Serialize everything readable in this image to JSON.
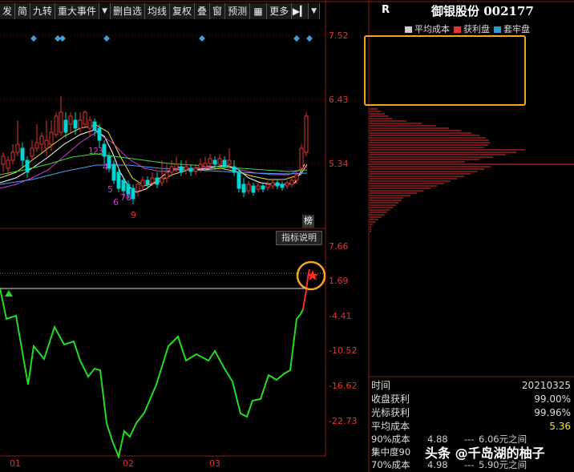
{
  "toolbar": {
    "items": [
      "发",
      "简",
      "九转",
      "重大事件",
      "删自选",
      "均线",
      "复权",
      "叠",
      "窗",
      "预测",
      "更多"
    ],
    "dropdown_after": "重大事件"
  },
  "stock": {
    "prefix": "R",
    "name": "御银股份 002177"
  },
  "legend": {
    "items": [
      {
        "label": "平均成本",
        "color": "#cccccc"
      },
      {
        "label": "获利盘",
        "color": "#e53333"
      },
      {
        "label": "套牢盘",
        "color": "#3399cc"
      }
    ]
  },
  "price_axis": {
    "labels": [
      "7.52",
      "6.43",
      "5.34"
    ]
  },
  "indicator_axis": {
    "labels": [
      "7.66",
      "1.69",
      "-4.41",
      "-10.52",
      "-16.62",
      "-22.73"
    ]
  },
  "date_axis": {
    "labels": [
      "01",
      "02",
      "03"
    ]
  },
  "wave_labels": [
    "1",
    "2",
    "3",
    "4",
    "5",
    "6",
    "7",
    "8",
    "9"
  ],
  "tags": {
    "bang": "榜",
    "indicator_help": "指标说明"
  },
  "info": {
    "rows": [
      {
        "label": "时间",
        "value": "20210325",
        "yellow": false
      },
      {
        "label": "收盘获利",
        "value": "99.00%",
        "yellow": false
      },
      {
        "label": "光标获利",
        "value": "99.96%",
        "yellow": false
      },
      {
        "label": "平均成本",
        "value": "5.36",
        "yellow": true
      }
    ]
  },
  "concentration": {
    "rows": [
      {
        "label": "90%成本",
        "low": "4.88",
        "sep": "---",
        "high": "6.06元之间"
      },
      {
        "label": "集中度90",
        "low": "",
        "sep": "",
        "high": ""
      },
      {
        "label": "70%成本",
        "low": "4.98",
        "sep": "---",
        "high": "5.90元之间"
      }
    ]
  },
  "watermark": "头条 @千岛湖的柚子",
  "colors": {
    "up": "#e53333",
    "down": "#00d4d4",
    "indicator_green": "#22dd22",
    "indicator_red": "#ff2a2a",
    "highlight": "#f5a623",
    "diamond": "#3fa0d8"
  }
}
